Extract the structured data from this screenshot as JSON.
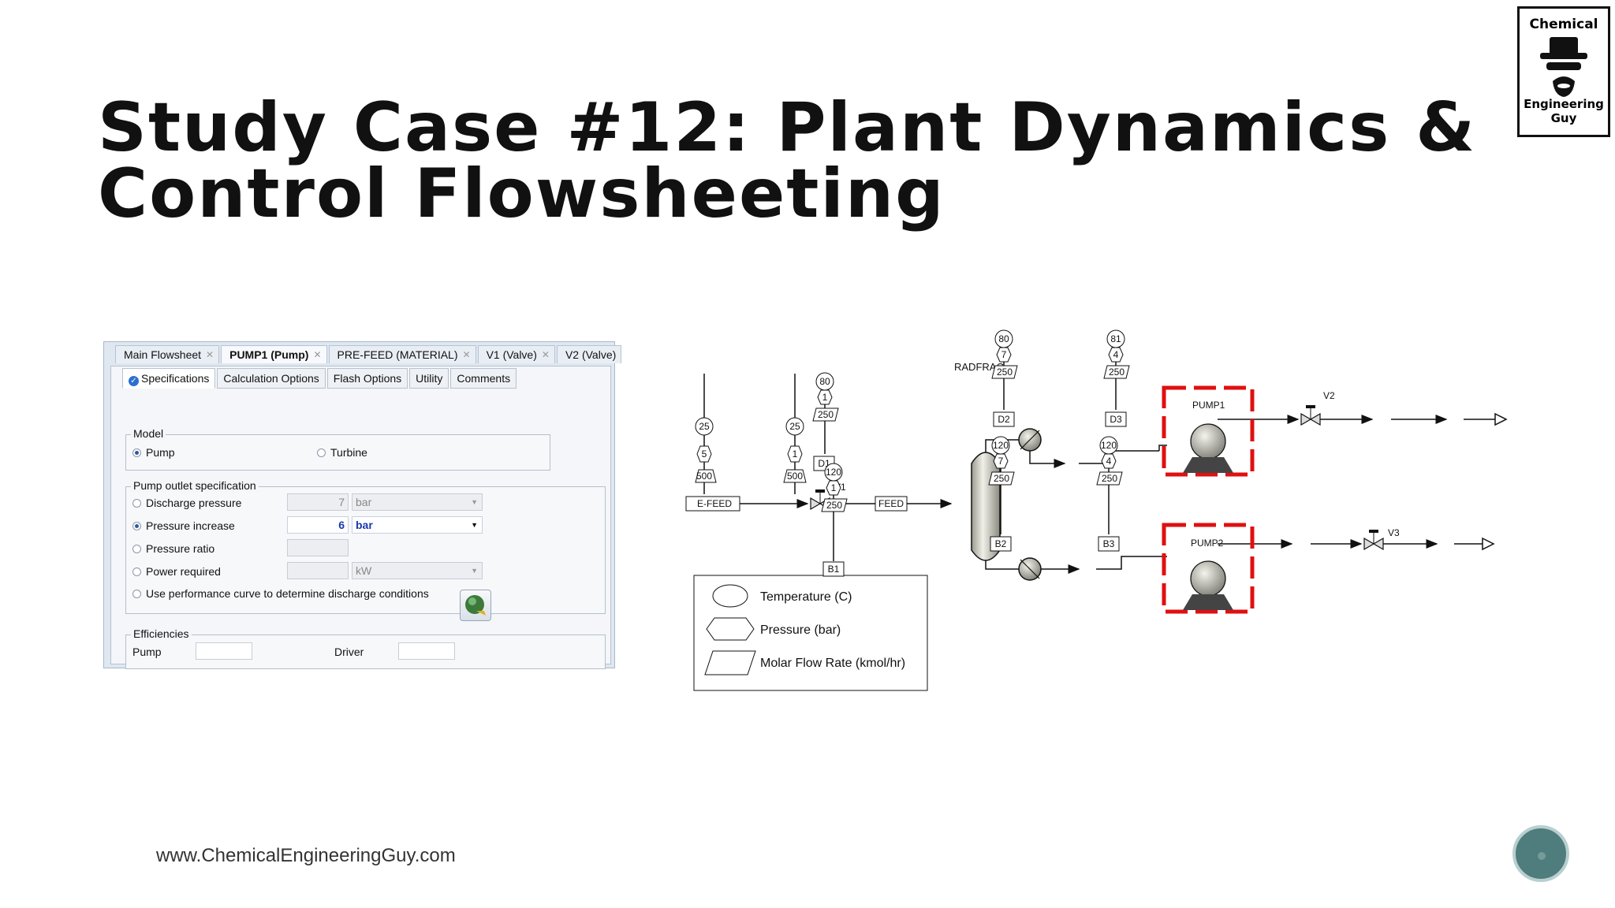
{
  "slide": {
    "title": "Study Case #12: Plant Dynamics & Control Flowsheeting",
    "footer_url": "www.ChemicalEngineeringGuy.com",
    "logo_top": "Chemical",
    "logo_bottom": "Engineering Guy"
  },
  "dialog": {
    "doc_tabs": [
      "Main Flowsheet",
      "PUMP1 (Pump)",
      "PRE-FEED (MATERIAL)",
      "V1 (Valve)",
      "V2 (Valve)"
    ],
    "active_doc_tab": "PUMP1 (Pump)",
    "sub_tabs": [
      "Specifications",
      "Calculation Options",
      "Flash Options",
      "Utility",
      "Comments"
    ],
    "active_sub_tab": "Specifications",
    "model": {
      "label": "Model",
      "options": [
        "Pump",
        "Turbine"
      ],
      "selected": "Pump"
    },
    "outlet_spec": {
      "label": "Pump outlet specification",
      "options": [
        {
          "label": "Discharge pressure",
          "value": "7",
          "unit": "bar",
          "selected": false
        },
        {
          "label": "Pressure increase",
          "value": "6",
          "unit": "bar",
          "selected": true
        },
        {
          "label": "Pressure ratio",
          "value": "",
          "unit": "",
          "selected": false
        },
        {
          "label": "Power required",
          "value": "",
          "unit": "kW",
          "selected": false
        },
        {
          "label": "Use performance curve to determine discharge conditions",
          "value": "",
          "unit": "",
          "selected": false
        }
      ]
    },
    "efficiencies": {
      "label": "Efficiencies",
      "pump_label": "Pump",
      "pump_value": "",
      "driver_label": "Driver",
      "driver_value": ""
    }
  },
  "flowsheet": {
    "column_label": "RADFRAC",
    "pump1_label": "PUMP1",
    "pump2_label": "PUMP2",
    "valves": [
      "V1",
      "V2",
      "V3"
    ],
    "streams": {
      "prefeed": {
        "name": "E-FEED",
        "temperature": "25",
        "pressure": "5",
        "flow": "500"
      },
      "feed": {
        "name": "FEED",
        "temperature": "25",
        "pressure": "1",
        "flow": "500"
      },
      "d1": {
        "name": "D1",
        "temperature": "80",
        "pressure": "1",
        "flow": "250"
      },
      "d2": {
        "name": "D2",
        "temperature": "80",
        "pressure": "7",
        "flow": "250"
      },
      "d3": {
        "name": "D3",
        "temperature": "81",
        "pressure": "4",
        "flow": "250"
      },
      "b1": {
        "name": "B1",
        "temperature": "120",
        "pressure": "1",
        "flow": "250"
      },
      "b2": {
        "name": "B2",
        "temperature": "120",
        "pressure": "7",
        "flow": "250"
      },
      "b3": {
        "name": "B3",
        "temperature": "120",
        "pressure": "4",
        "flow": "250"
      }
    },
    "legend": {
      "temperature": "Temperature (C)",
      "pressure": "Pressure (bar)",
      "flow": "Molar Flow Rate (kmol/hr)"
    },
    "highlight_color": "#e01010"
  }
}
